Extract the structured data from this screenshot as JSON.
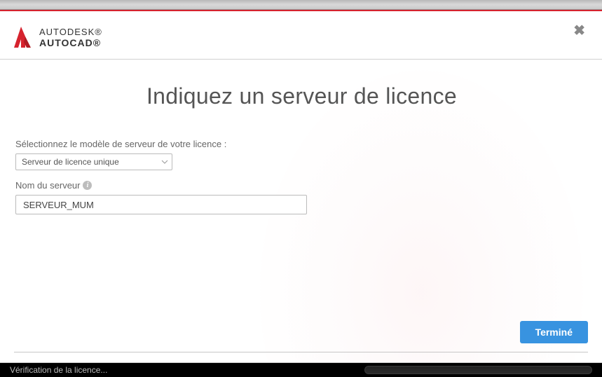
{
  "brand": {
    "top": "AUTODESK®",
    "bottom": "AUTOCAD®"
  },
  "dialog": {
    "title": "Indiquez un serveur de licence",
    "model_label": "Sélectionnez le modèle de serveur de votre licence :",
    "model_selected": "Serveur de licence unique",
    "server_name_label": "Nom du serveur",
    "server_name_value": "SERVEUR_MUM",
    "done_button": "Terminé"
  },
  "status": {
    "text": "Vérification de la licence..."
  },
  "colors": {
    "brand_red": "#d6232e",
    "primary_button": "#3893e0"
  }
}
